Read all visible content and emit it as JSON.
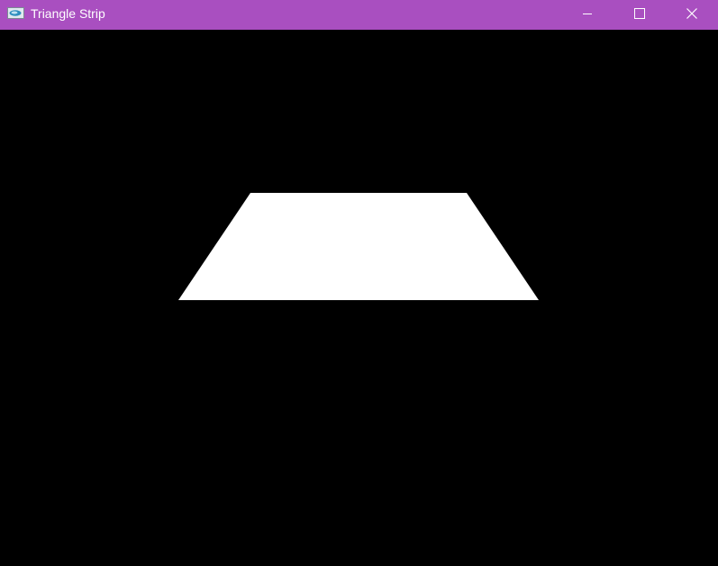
{
  "window": {
    "title": "Triangle Strip",
    "titlebar_color": "#A94FC0",
    "background_color": "#000000",
    "shape_color": "#FFFFFF"
  },
  "titlebar": {
    "app_icon": "app-icon",
    "controls": [
      {
        "name": "minimize-button",
        "icon": "minimize-icon"
      },
      {
        "name": "maximize-button",
        "icon": "maximize-icon"
      },
      {
        "name": "close-button",
        "icon": "close-icon"
      }
    ]
  }
}
